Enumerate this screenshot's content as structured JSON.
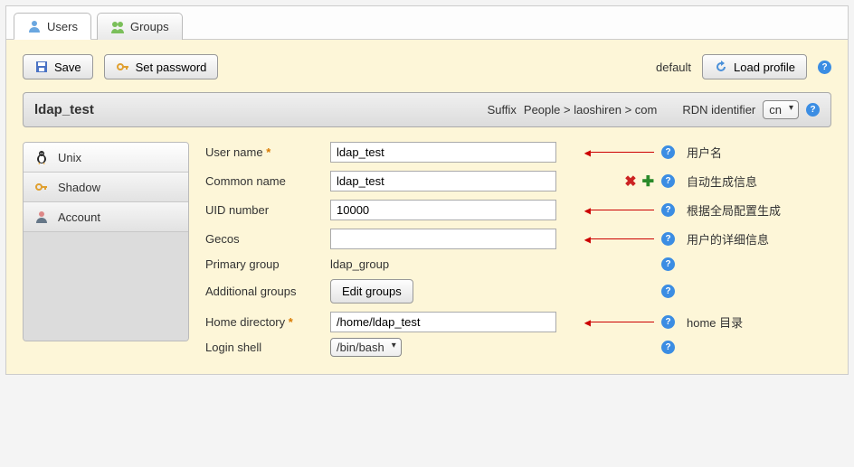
{
  "tabs": {
    "users": "Users",
    "groups": "Groups"
  },
  "toolbar": {
    "save": "Save",
    "set_password": "Set password",
    "default": "default",
    "load_profile": "Load profile"
  },
  "header": {
    "title": "ldap_test",
    "suffix_label": "Suffix",
    "suffix_value": "People > laoshiren > com",
    "rdn_label": "RDN identifier",
    "rdn_value": "cn"
  },
  "sidebar": {
    "unix": "Unix",
    "shadow": "Shadow",
    "account": "Account"
  },
  "form": {
    "username_label": "User name",
    "username_value": "ldap_test",
    "common_label": "Common name",
    "common_value": "ldap_test",
    "uid_label": "UID number",
    "uid_value": "10000",
    "gecos_label": "Gecos",
    "gecos_value": "",
    "primary_label": "Primary group",
    "primary_value": "ldap_group",
    "additional_label": "Additional groups",
    "edit_groups": "Edit groups",
    "home_label": "Home directory",
    "home_value": "/home/ldap_test",
    "shell_label": "Login shell",
    "shell_value": "/bin/bash"
  },
  "annotations": {
    "username": "用户名",
    "common": "自动生成信息",
    "uid": "根据全局配置生成",
    "gecos": "用户的详细信息",
    "home": "home 目录"
  }
}
